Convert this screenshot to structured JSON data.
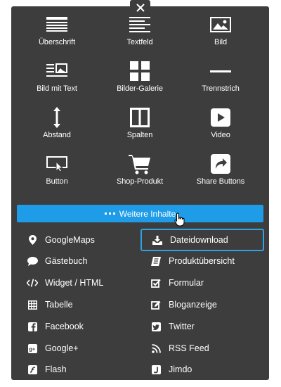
{
  "close_icon": "close-icon",
  "tiles": [
    {
      "label": "Überschrift",
      "icon": "heading-icon"
    },
    {
      "label": "Textfeld",
      "icon": "textfield-icon"
    },
    {
      "label": "Bild",
      "icon": "image-icon"
    },
    {
      "label": "Bild mit Text",
      "icon": "image-with-text-icon"
    },
    {
      "label": "Bilder-Galerie",
      "icon": "gallery-icon"
    },
    {
      "label": "Trennstrich",
      "icon": "divider-icon"
    },
    {
      "label": "Abstand",
      "icon": "spacing-icon"
    },
    {
      "label": "Spalten",
      "icon": "columns-icon"
    },
    {
      "label": "Video",
      "icon": "video-icon"
    },
    {
      "label": "Button",
      "icon": "button-icon"
    },
    {
      "label": "Shop-Produkt",
      "icon": "shopping-cart-icon"
    },
    {
      "label": "Share Buttons",
      "icon": "share-icon"
    }
  ],
  "more_button": {
    "label": "Weitere Inhalte",
    "color": "#1f9ce8"
  },
  "list": {
    "left": [
      {
        "label": "GoogleMaps",
        "icon": "map-pin-icon"
      },
      {
        "label": "Gästebuch",
        "icon": "speech-bubble-icon"
      },
      {
        "label": "Widget / HTML",
        "icon": "code-icon"
      },
      {
        "label": "Tabelle",
        "icon": "table-icon"
      },
      {
        "label": "Facebook",
        "icon": "facebook-icon"
      },
      {
        "label": "Google+",
        "icon": "google-plus-icon"
      },
      {
        "label": "Flash",
        "icon": "flash-icon"
      }
    ],
    "right": [
      {
        "label": "Dateidownload",
        "icon": "download-icon",
        "selected": true
      },
      {
        "label": "Produktübersicht",
        "icon": "product-overview-icon"
      },
      {
        "label": "Formular",
        "icon": "form-checkbox-icon"
      },
      {
        "label": "Bloganzeige",
        "icon": "blog-edit-icon"
      },
      {
        "label": "Twitter",
        "icon": "twitter-icon"
      },
      {
        "label": "RSS Feed",
        "icon": "rss-icon"
      },
      {
        "label": "Jimdo",
        "icon": "jimdo-icon"
      }
    ]
  },
  "colors": {
    "panel": "#3d3d3d",
    "accent": "#1f9ce8",
    "selected_border": "#2da3e8"
  }
}
